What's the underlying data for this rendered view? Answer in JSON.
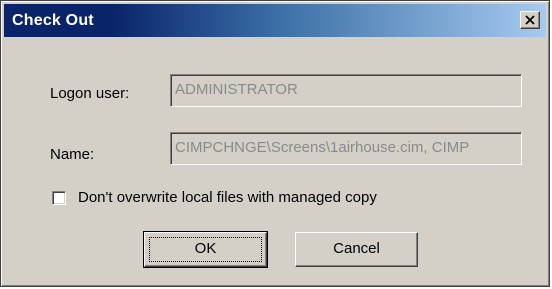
{
  "window": {
    "title": "Check Out",
    "close_icon": "close-icon"
  },
  "form": {
    "logon_user_label": "Logon user:",
    "logon_user_value": "ADMINISTRATOR",
    "name_label": "Name:",
    "name_value": "CIMPCHNGE\\Screens\\1airhouse.cim, CIMP",
    "checkbox_label": "Don't overwrite local files with managed copy",
    "checkbox_checked": false
  },
  "buttons": {
    "ok_label": "OK",
    "cancel_label": "Cancel"
  },
  "colors": {
    "title_gradient_start": "#0a246a",
    "title_gradient_end": "#a6caf0",
    "dialog_face": "#d4d0c8",
    "disabled_text": "#8a8a8a"
  }
}
